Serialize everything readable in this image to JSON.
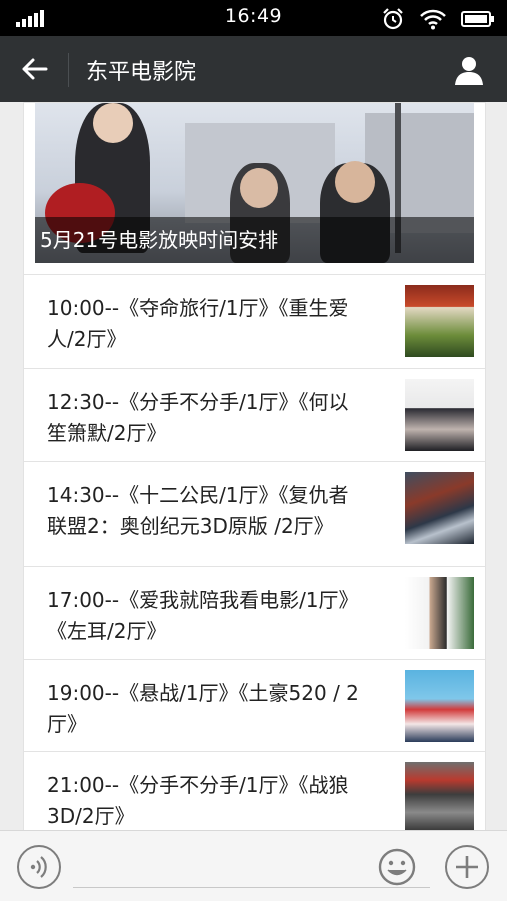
{
  "status_bar": {
    "time": "16:49",
    "icons": [
      "signal-icon",
      "alarm-icon",
      "wifi-icon",
      "battery-icon"
    ]
  },
  "header": {
    "back_icon": "back-arrow-icon",
    "title": "东平电影院",
    "profile_icon": "user-icon"
  },
  "banner": {
    "caption": "5月21号电影放映时间安排"
  },
  "schedule": [
    {
      "text": "10:00--《夺命旅行/1厅》《重生爱人/2厅》"
    },
    {
      "text": "12:30--《分手不分手/1厅》《何以笙箫默/2厅》"
    },
    {
      "text": "14:30--《十二公民/1厅》《复仇者联盟2：奥创纪元3D原版 /2厅》"
    },
    {
      "text": "17:00--《爱我就陪我看电影/1厅》《左耳/2厅》"
    },
    {
      "text": "19:00--《悬战/1厅》《土豪520 / 2厅》"
    },
    {
      "text": "21:00--《分手不分手/1厅》《战狼3D/2厅》"
    }
  ],
  "bottom_bar": {
    "voice_icon": "voice-icon",
    "emoji_icon": "emoji-icon",
    "add_icon": "plus-icon"
  },
  "colors": {
    "status_bg": "#000000",
    "header_bg": "#2f3234",
    "page_bg": "#ededed"
  }
}
